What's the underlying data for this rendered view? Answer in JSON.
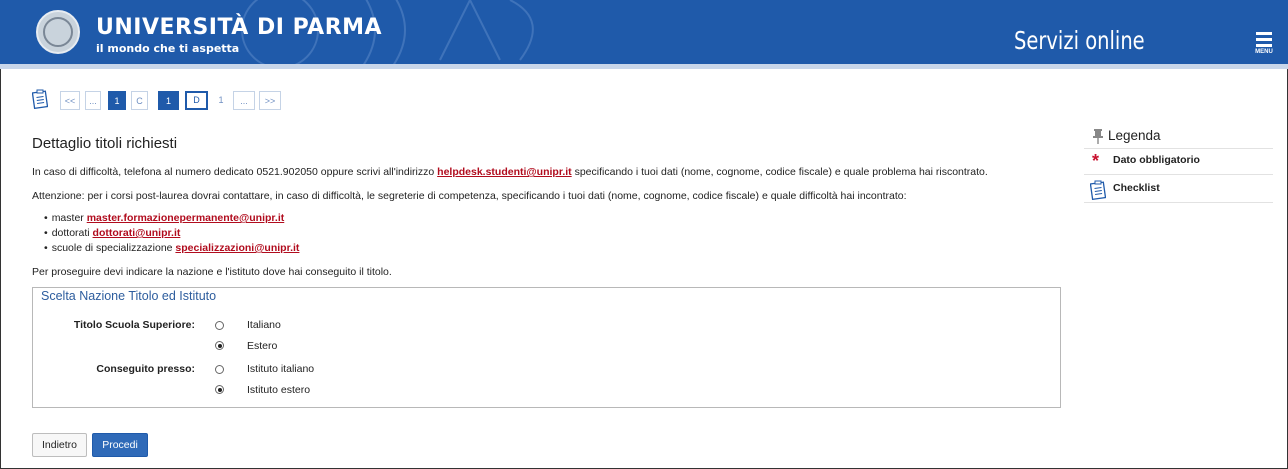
{
  "header": {
    "title": "UNIVERSITÀ DI PARMA",
    "subtitle": "il mondo che ti aspetta",
    "service": "Servizi online",
    "menu_label": "MENU",
    "brand_color": "#1f5aaa"
  },
  "stepper": {
    "icon": "checklist-icon",
    "items": [
      "<<",
      "...",
      "1",
      "C",
      "1",
      "D",
      "1",
      "...",
      ">>"
    ]
  },
  "main": {
    "title": "Dettaglio titoli richiesti",
    "help_text_before": "In caso di difficoltà, telefona al numero dedicato 0521.902050 oppure scrivi all'indirizzo ",
    "help_email": "helpdesk.studenti@unipr.it",
    "help_text_after": " specificando i tuoi dati (nome, cognome, codice fiscale) e quale problema hai riscontrato.",
    "attention_text": "Attenzione: per i corsi post-laurea dovrai contattare, in caso di difficoltà, le segreterie di competenza, specificando i tuoi dati (nome, cognome, codice fiscale) e quale difficoltà hai incontrato:",
    "contacts": [
      {
        "label": "master ",
        "email": "master.formazionepermanente@unipr.it"
      },
      {
        "label": "dottorati ",
        "email": "dottorati@unipr.it"
      },
      {
        "label": "scuole di specializzazione ",
        "email": "specializzazioni@unipr.it"
      }
    ],
    "proceed_text": "Per proseguire devi indicare la nazione e l'istituto dove hai conseguito il titolo."
  },
  "form": {
    "legend": "Scelta Nazione Titolo ed Istituto",
    "titolo_label": "Titolo Scuola Superiore:",
    "titolo_options": [
      {
        "label": "Italiano",
        "selected": false
      },
      {
        "label": "Estero",
        "selected": true
      }
    ],
    "conseguito_label": "Conseguito presso:",
    "conseguito_options": [
      {
        "label": "Istituto italiano",
        "selected": false
      },
      {
        "label": "Istituto estero",
        "selected": true
      }
    ]
  },
  "buttons": {
    "back": "Indietro",
    "next": "Procedi"
  },
  "sidebar": {
    "title": "Legenda",
    "items": [
      {
        "icon": "required-star-icon",
        "label": "Dato obbligatorio"
      },
      {
        "icon": "checklist-icon",
        "label": "Checklist"
      }
    ]
  }
}
